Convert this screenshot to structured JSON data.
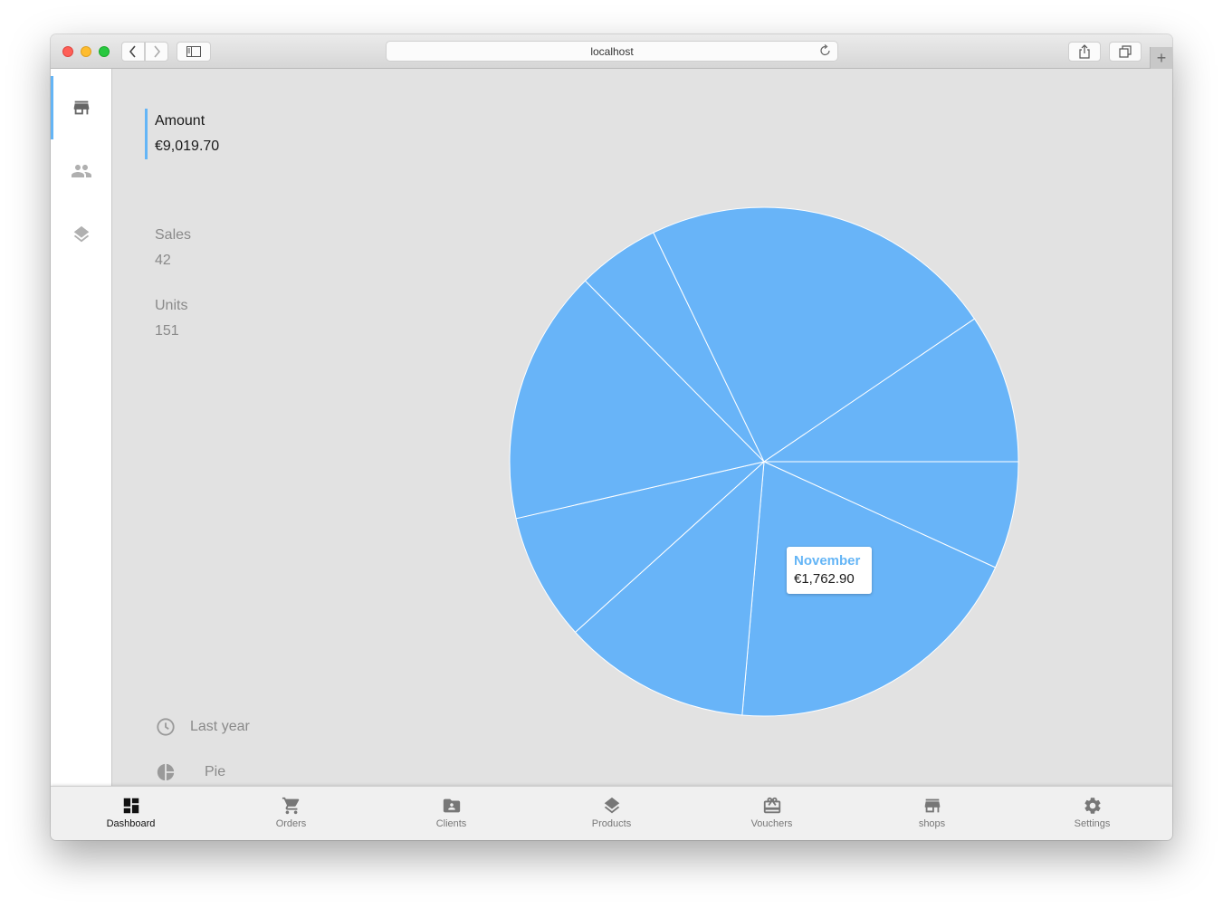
{
  "browser": {
    "url": "localhost",
    "buttons": {
      "back": "back",
      "forward": "forward",
      "sidebar": "sidebar",
      "share": "share",
      "tabs": "tabs",
      "new_tab": "+"
    }
  },
  "sidebar": {
    "items": [
      {
        "name": "shops",
        "icon": "store-icon",
        "active": true
      },
      {
        "name": "clients",
        "icon": "people-icon",
        "active": false
      },
      {
        "name": "products",
        "icon": "layers-icon",
        "active": false
      }
    ]
  },
  "metrics": [
    {
      "label": "Amount",
      "value": "€9,019.70",
      "active": true
    },
    {
      "label": "Sales",
      "value": "42",
      "active": false
    },
    {
      "label": "Units",
      "value": "151",
      "active": false
    }
  ],
  "options": {
    "period": {
      "icon": "clock-icon",
      "label": "Last year"
    },
    "chart_type": {
      "icon": "pie-chart-icon",
      "label": "Pie"
    }
  },
  "tooltip": {
    "title": "November",
    "value": "€1,762.90"
  },
  "colors": {
    "accent": "#64b5f6",
    "slice": "#68b4f8",
    "slice_border": "#ffffff"
  },
  "chart_data": {
    "type": "pie",
    "title": "",
    "total": 9019.7,
    "currency": "€",
    "start_angle_deg": 0,
    "direction": "clockwise",
    "slices": [
      {
        "label": "",
        "value": 615.8
      },
      {
        "label": "November",
        "value": 1762.9
      },
      {
        "label": "",
        "value": 1076.5
      },
      {
        "label": "",
        "value": 731.0
      },
      {
        "label": "",
        "value": 1459.5
      },
      {
        "label": "",
        "value": 473.1
      },
      {
        "label": "",
        "value": 2044.7
      },
      {
        "label": "",
        "value": 856.2
      }
    ],
    "highlighted": "November",
    "legend": "none"
  },
  "bottom_nav": {
    "items": [
      {
        "label": "Dashboard",
        "icon": "dashboard-icon",
        "active": true
      },
      {
        "label": "Orders",
        "icon": "cart-icon",
        "active": false
      },
      {
        "label": "Clients",
        "icon": "client-folder-icon",
        "active": false
      },
      {
        "label": "Products",
        "icon": "layers-icon",
        "active": false
      },
      {
        "label": "Vouchers",
        "icon": "voucher-icon",
        "active": false
      },
      {
        "label": "shops",
        "icon": "store-icon",
        "active": false
      },
      {
        "label": "Settings",
        "icon": "gear-icon",
        "active": false
      }
    ]
  }
}
